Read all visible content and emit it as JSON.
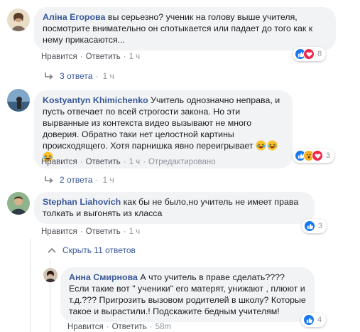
{
  "comments": [
    {
      "author": "Аліна Егорова",
      "text": "вы серьезно? ученик на голову выше учителя, посмотрите внимательно он спотыкается или падает до того как к нему прикасаются...",
      "like": "Нравится",
      "reply": "Ответить",
      "time": "1 ч",
      "reactions_count": "8",
      "replies_label": "3 ответа",
      "replies_time": "1 ч",
      "reaction_icons": [
        "like-icon",
        "love-icon"
      ]
    },
    {
      "author": "Kostyantyn Khimichenko",
      "text": "Учитель однозначно неправа, и пусть отвечает по всей строгости закона. Но эти вырванные из контекста видео вызывают не много доверия. Обратно таки нет целостной картины происходящего. Хотя парнишка явно переигрывает",
      "emoji": "laughing-emoji",
      "like": "Нравится",
      "reply": "Ответить",
      "time": "1 ч",
      "edited": "Отредактировано",
      "reactions_count": "3",
      "replies_label": "2 ответа",
      "replies_time": "1 ч",
      "reaction_icons": [
        "like-icon",
        "wow-icon",
        "love-icon"
      ]
    },
    {
      "author": "Stephan Liahovich",
      "text": "как бы не было,но учитель не имеет права толкать и выгонять из класса",
      "like": "Нравится",
      "reply": "Ответить",
      "time": "1 ч",
      "reactions_count": "3",
      "hide_replies": "Скрыть 11 ответов",
      "reaction_icons": [
        "like-icon"
      ]
    }
  ],
  "reply": {
    "author": "Анна Смирнова",
    "text": "А что учитель в праве сделать???? Если такие вот \" ученики\" его матерят, унижают , плюют и т.д.??? Пригрозить вызовом родителей в школу? Которые такое и вырастили.! Подскажите бедным учителям!",
    "like": "Нравится",
    "reply": "Ответить",
    "time": "58m",
    "reactions_count": "4",
    "reaction_icons": [
      "like-icon"
    ]
  },
  "colors": {
    "link": "#385898",
    "bubble": "#f2f3f5",
    "like": "#1877f2",
    "love": "#f0284a",
    "wow": "#f7b125"
  }
}
